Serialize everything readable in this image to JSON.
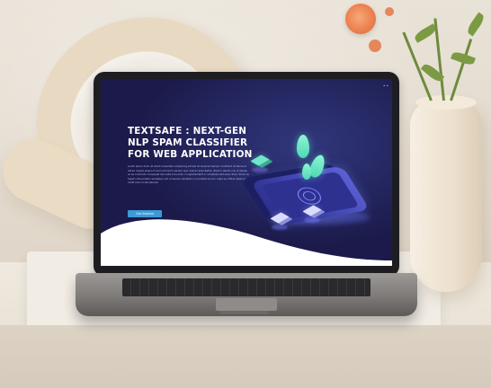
{
  "hero": {
    "title": "TEXTSAFE : NEXT-GEN NLP SPAM CLASSIFIER FOR WEB APPLICATION",
    "description": "Lorem ipsum dolor sit amet consectetur adipiscing elit sed do eiusmod tempor incididunt ut labore et dolore magna aliqua ut enim ad minim veniam quis nostrud exercitation ullamco laboris nisi ut aliquip ex ea commodo consequat duis aute irure dolor in reprehenderit in voluptate velit esse cillum dolore eu fugiat nulla pariatur excepteur sint occaecat cupidatat non proident sunt in culpa qui officia deserunt mollit anim id est laborum",
    "cta_label": "Get Started"
  },
  "nav": {
    "corner_link": "• •"
  },
  "colors": {
    "screen_bg": "#1b1a4a",
    "accent": "#3d9ad6",
    "teal": "#6fe6c8",
    "flower": "#ee8452"
  }
}
